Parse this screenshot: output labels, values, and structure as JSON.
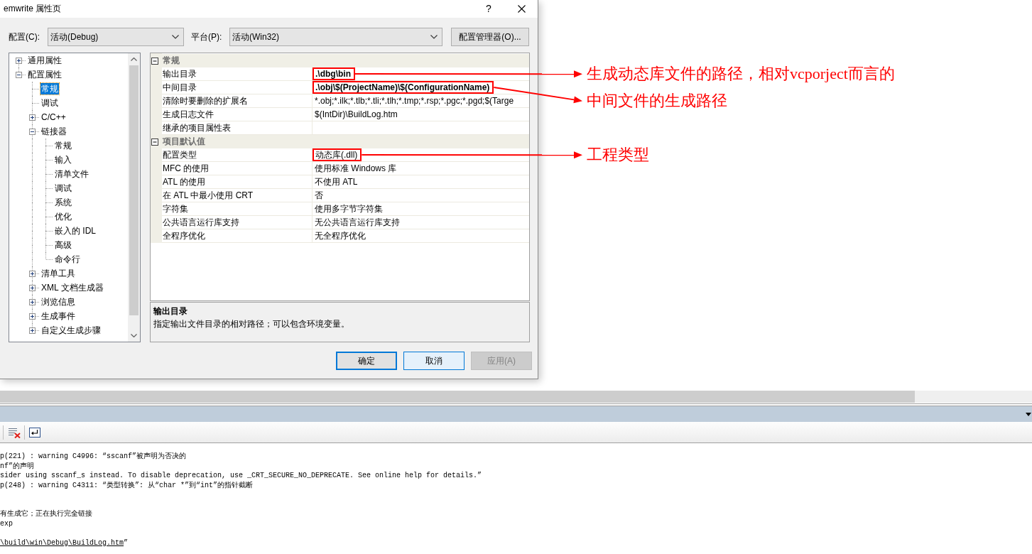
{
  "dialog": {
    "title": "emwrite 属性页",
    "help_button": "?",
    "configuration": {
      "label": "配置(C):",
      "value": "活动(Debug)"
    },
    "platform": {
      "label": "平台(P):",
      "value": "活动(Win32)"
    },
    "manager_button": "配置管理器(O)...",
    "tree": [
      {
        "label": "通用属性",
        "expanded": false,
        "selected": false
      },
      {
        "label": "配置属性",
        "expanded": true,
        "selected": false,
        "children": [
          {
            "label": "常规",
            "selected": true
          },
          {
            "label": "调试",
            "selected": false
          },
          {
            "label": "C/C++",
            "expanded": false,
            "selected": false
          },
          {
            "label": "链接器",
            "expanded": true,
            "selected": false,
            "children": [
              {
                "label": "常规",
                "selected": false
              },
              {
                "label": "输入",
                "selected": false
              },
              {
                "label": "清单文件",
                "selected": false
              },
              {
                "label": "调试",
                "selected": false
              },
              {
                "label": "系统",
                "selected": false
              },
              {
                "label": "优化",
                "selected": false
              },
              {
                "label": "嵌入的 IDL",
                "selected": false
              },
              {
                "label": "高级",
                "selected": false
              },
              {
                "label": "命令行",
                "selected": false
              }
            ]
          },
          {
            "label": "清单工具",
            "expanded": false,
            "selected": false
          },
          {
            "label": "XML 文档生成器",
            "expanded": false,
            "selected": false
          },
          {
            "label": "浏览信息",
            "expanded": false,
            "selected": false
          },
          {
            "label": "生成事件",
            "expanded": false,
            "selected": false
          },
          {
            "label": "自定义生成步骤",
            "expanded": false,
            "selected": false
          }
        ]
      }
    ],
    "property_grid": [
      {
        "category": "常规",
        "expanded": true,
        "rows": [
          {
            "name": "输出目录",
            "value": ".\\dbg\\bin",
            "bold": true,
            "annotation": "生成动态库文件的路径，相对vcporject而言的"
          },
          {
            "name": "中间目录",
            "value": ".\\obj\\$(ProjectName)\\$(ConfigurationName)",
            "bold": true,
            "annotation": "中间文件的生成路径"
          },
          {
            "name": "清除时要删除的扩展名",
            "value": "*.obj;*.ilk;*.tlb;*.tli;*.tlh;*.tmp;*.rsp;*.pgc;*.pgd;$(Targe",
            "bold": false
          },
          {
            "name": "生成日志文件",
            "value": "$(IntDir)\\BuildLog.htm",
            "bold": false
          },
          {
            "name": "继承的项目属性表"
          }
        ]
      },
      {
        "category": "项目默认值",
        "expanded": true,
        "rows": [
          {
            "name": "配置类型",
            "value": "动态库(.dll)",
            "bold": false,
            "annotation": "工程类型"
          },
          {
            "name": "MFC 的使用",
            "value": "使用标准 Windows 库",
            "bold": false
          },
          {
            "name": "ATL 的使用",
            "value": "不使用 ATL",
            "bold": false
          },
          {
            "name": "在 ATL 中最小使用 CRT",
            "value": "否",
            "bold": false
          },
          {
            "name": "字符集",
            "value": "使用多字节字符集",
            "bold": false
          },
          {
            "name": "公共语言运行库支持",
            "value": "无公共语言运行库支持",
            "bold": false
          },
          {
            "name": "全程序优化",
            "value": "无全程序优化",
            "bold": false
          }
        ]
      }
    ],
    "description": {
      "title": "输出目录",
      "text": "指定输出文件目录的相对路径；可以包含环境变量。"
    },
    "buttons": [
      {
        "label": "确定",
        "kind": "default",
        "disabled": false
      },
      {
        "label": "取消",
        "kind": "hover",
        "disabled": false
      },
      {
        "label": "应用(A)",
        "kind": "normal",
        "disabled": true
      }
    ]
  },
  "output_panel": {
    "lines": [
      {
        "kind": "text",
        "text": "p(221) : warning C4996: “sscanf”被声明为否决的"
      },
      {
        "kind": "text",
        "text": "nf”的声明"
      },
      {
        "kind": "text",
        "text": "sider using sscanf_s instead. To disable deprecation, use _CRT_SECURE_NO_DEPRECATE. See online help for details.”"
      },
      {
        "kind": "text",
        "text": "p(248) : warning C4311: “类型转换”: 从“char *”到“int”的指针截断"
      },
      {
        "kind": "blank"
      },
      {
        "kind": "blank"
      },
      {
        "kind": "text",
        "text": "有生成它；正在执行完全链接"
      },
      {
        "kind": "text",
        "text": "exp"
      },
      {
        "kind": "blank"
      },
      {
        "kind": "link",
        "link": "\\build\\win\\Debug\\BuildLog.htm",
        "text": "”"
      }
    ]
  }
}
